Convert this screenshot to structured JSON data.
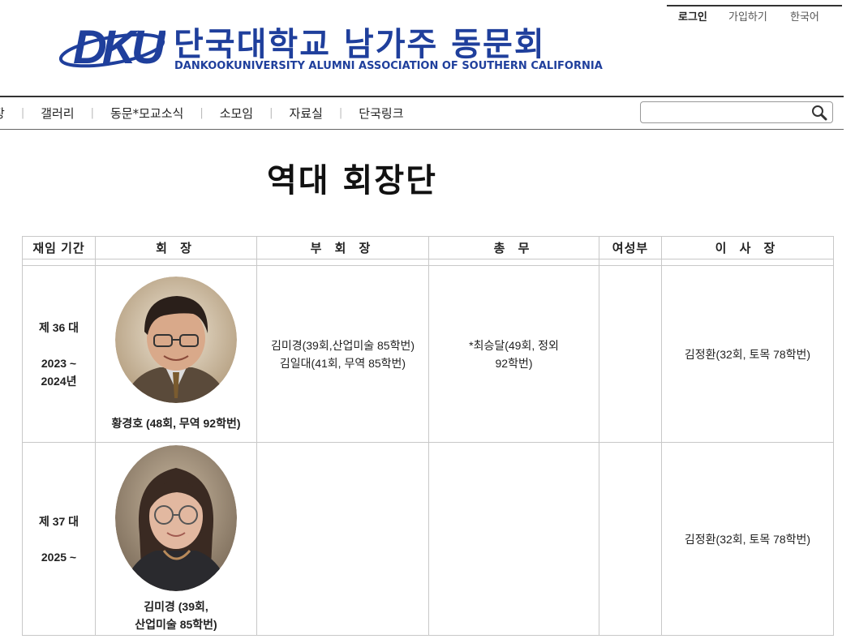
{
  "top_links": {
    "login": "로그인",
    "join": "가입하기",
    "language": "한국어"
  },
  "logo": {
    "mark_text": "DKU",
    "title": "단국대학교 남가주 동문회",
    "subtitle": "DANKOOKUNIVERSITY ALUMNI ASSOCIATION OF SOUTHERN CALIFORNIA"
  },
  "nav": {
    "clipped_item": "장",
    "items": [
      "갤러리",
      "동문*모교소식",
      "소모임",
      "자료실",
      "단국링크"
    ],
    "separator": "|"
  },
  "search": {
    "placeholder": ""
  },
  "page_title": "역대 회장단",
  "table": {
    "headers": [
      "재임 기간",
      "회 장",
      "부 회 장",
      "총 무",
      "여성부",
      "이 사 장"
    ],
    "rows": [
      {
        "term": "제 36 대",
        "years_line1": "2023 ~",
        "years_line2": "2024년",
        "president_name": "황경호 (48회, 무역 92학번)",
        "vice_presidents": [
          "김미경(39회,산업미술 85학번)",
          "김일대(41회,  무역   85학번)"
        ],
        "secretary_line1": "*최승달(49회, 정외",
        "secretary_line2": "92학번)",
        "women": "",
        "chairman": "김정환(32회, 토목 78학번)"
      },
      {
        "term": "제 37 대",
        "years_line1": "2025 ~",
        "years_line2": "",
        "president_name_line1": "김미경 (39회,",
        "president_name_line2": "산업미술 85학번)",
        "vice_presidents": [],
        "secretary_line1": "",
        "secretary_line2": "",
        "women": "",
        "chairman": "김정환(32회, 토목 78학번)"
      }
    ]
  },
  "colors": {
    "brand_blue": "#1f3f9c",
    "border": "#c8c8c8"
  }
}
